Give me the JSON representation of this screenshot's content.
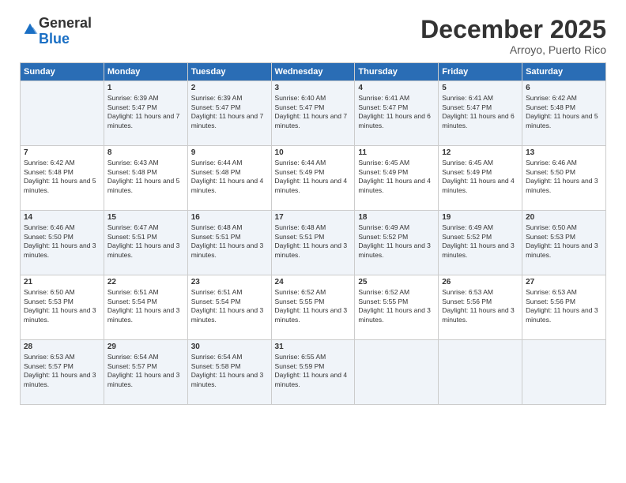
{
  "logo": {
    "general": "General",
    "blue": "Blue"
  },
  "title": "December 2025",
  "location": "Arroyo, Puerto Rico",
  "days_of_week": [
    "Sunday",
    "Monday",
    "Tuesday",
    "Wednesday",
    "Thursday",
    "Friday",
    "Saturday"
  ],
  "weeks": [
    [
      {
        "day": "",
        "sunrise": "",
        "sunset": "",
        "daylight": ""
      },
      {
        "day": "1",
        "sunrise": "Sunrise: 6:39 AM",
        "sunset": "Sunset: 5:47 PM",
        "daylight": "Daylight: 11 hours and 7 minutes."
      },
      {
        "day": "2",
        "sunrise": "Sunrise: 6:39 AM",
        "sunset": "Sunset: 5:47 PM",
        "daylight": "Daylight: 11 hours and 7 minutes."
      },
      {
        "day": "3",
        "sunrise": "Sunrise: 6:40 AM",
        "sunset": "Sunset: 5:47 PM",
        "daylight": "Daylight: 11 hours and 7 minutes."
      },
      {
        "day": "4",
        "sunrise": "Sunrise: 6:41 AM",
        "sunset": "Sunset: 5:47 PM",
        "daylight": "Daylight: 11 hours and 6 minutes."
      },
      {
        "day": "5",
        "sunrise": "Sunrise: 6:41 AM",
        "sunset": "Sunset: 5:47 PM",
        "daylight": "Daylight: 11 hours and 6 minutes."
      },
      {
        "day": "6",
        "sunrise": "Sunrise: 6:42 AM",
        "sunset": "Sunset: 5:48 PM",
        "daylight": "Daylight: 11 hours and 5 minutes."
      }
    ],
    [
      {
        "day": "7",
        "sunrise": "Sunrise: 6:42 AM",
        "sunset": "Sunset: 5:48 PM",
        "daylight": "Daylight: 11 hours and 5 minutes."
      },
      {
        "day": "8",
        "sunrise": "Sunrise: 6:43 AM",
        "sunset": "Sunset: 5:48 PM",
        "daylight": "Daylight: 11 hours and 5 minutes."
      },
      {
        "day": "9",
        "sunrise": "Sunrise: 6:44 AM",
        "sunset": "Sunset: 5:48 PM",
        "daylight": "Daylight: 11 hours and 4 minutes."
      },
      {
        "day": "10",
        "sunrise": "Sunrise: 6:44 AM",
        "sunset": "Sunset: 5:49 PM",
        "daylight": "Daylight: 11 hours and 4 minutes."
      },
      {
        "day": "11",
        "sunrise": "Sunrise: 6:45 AM",
        "sunset": "Sunset: 5:49 PM",
        "daylight": "Daylight: 11 hours and 4 minutes."
      },
      {
        "day": "12",
        "sunrise": "Sunrise: 6:45 AM",
        "sunset": "Sunset: 5:49 PM",
        "daylight": "Daylight: 11 hours and 4 minutes."
      },
      {
        "day": "13",
        "sunrise": "Sunrise: 6:46 AM",
        "sunset": "Sunset: 5:50 PM",
        "daylight": "Daylight: 11 hours and 3 minutes."
      }
    ],
    [
      {
        "day": "14",
        "sunrise": "Sunrise: 6:46 AM",
        "sunset": "Sunset: 5:50 PM",
        "daylight": "Daylight: 11 hours and 3 minutes."
      },
      {
        "day": "15",
        "sunrise": "Sunrise: 6:47 AM",
        "sunset": "Sunset: 5:51 PM",
        "daylight": "Daylight: 11 hours and 3 minutes."
      },
      {
        "day": "16",
        "sunrise": "Sunrise: 6:48 AM",
        "sunset": "Sunset: 5:51 PM",
        "daylight": "Daylight: 11 hours and 3 minutes."
      },
      {
        "day": "17",
        "sunrise": "Sunrise: 6:48 AM",
        "sunset": "Sunset: 5:51 PM",
        "daylight": "Daylight: 11 hours and 3 minutes."
      },
      {
        "day": "18",
        "sunrise": "Sunrise: 6:49 AM",
        "sunset": "Sunset: 5:52 PM",
        "daylight": "Daylight: 11 hours and 3 minutes."
      },
      {
        "day": "19",
        "sunrise": "Sunrise: 6:49 AM",
        "sunset": "Sunset: 5:52 PM",
        "daylight": "Daylight: 11 hours and 3 minutes."
      },
      {
        "day": "20",
        "sunrise": "Sunrise: 6:50 AM",
        "sunset": "Sunset: 5:53 PM",
        "daylight": "Daylight: 11 hours and 3 minutes."
      }
    ],
    [
      {
        "day": "21",
        "sunrise": "Sunrise: 6:50 AM",
        "sunset": "Sunset: 5:53 PM",
        "daylight": "Daylight: 11 hours and 3 minutes."
      },
      {
        "day": "22",
        "sunrise": "Sunrise: 6:51 AM",
        "sunset": "Sunset: 5:54 PM",
        "daylight": "Daylight: 11 hours and 3 minutes."
      },
      {
        "day": "23",
        "sunrise": "Sunrise: 6:51 AM",
        "sunset": "Sunset: 5:54 PM",
        "daylight": "Daylight: 11 hours and 3 minutes."
      },
      {
        "day": "24",
        "sunrise": "Sunrise: 6:52 AM",
        "sunset": "Sunset: 5:55 PM",
        "daylight": "Daylight: 11 hours and 3 minutes."
      },
      {
        "day": "25",
        "sunrise": "Sunrise: 6:52 AM",
        "sunset": "Sunset: 5:55 PM",
        "daylight": "Daylight: 11 hours and 3 minutes."
      },
      {
        "day": "26",
        "sunrise": "Sunrise: 6:53 AM",
        "sunset": "Sunset: 5:56 PM",
        "daylight": "Daylight: 11 hours and 3 minutes."
      },
      {
        "day": "27",
        "sunrise": "Sunrise: 6:53 AM",
        "sunset": "Sunset: 5:56 PM",
        "daylight": "Daylight: 11 hours and 3 minutes."
      }
    ],
    [
      {
        "day": "28",
        "sunrise": "Sunrise: 6:53 AM",
        "sunset": "Sunset: 5:57 PM",
        "daylight": "Daylight: 11 hours and 3 minutes."
      },
      {
        "day": "29",
        "sunrise": "Sunrise: 6:54 AM",
        "sunset": "Sunset: 5:57 PM",
        "daylight": "Daylight: 11 hours and 3 minutes."
      },
      {
        "day": "30",
        "sunrise": "Sunrise: 6:54 AM",
        "sunset": "Sunset: 5:58 PM",
        "daylight": "Daylight: 11 hours and 3 minutes."
      },
      {
        "day": "31",
        "sunrise": "Sunrise: 6:55 AM",
        "sunset": "Sunset: 5:59 PM",
        "daylight": "Daylight: 11 hours and 4 minutes."
      },
      {
        "day": "",
        "sunrise": "",
        "sunset": "",
        "daylight": ""
      },
      {
        "day": "",
        "sunrise": "",
        "sunset": "",
        "daylight": ""
      },
      {
        "day": "",
        "sunrise": "",
        "sunset": "",
        "daylight": ""
      }
    ]
  ]
}
